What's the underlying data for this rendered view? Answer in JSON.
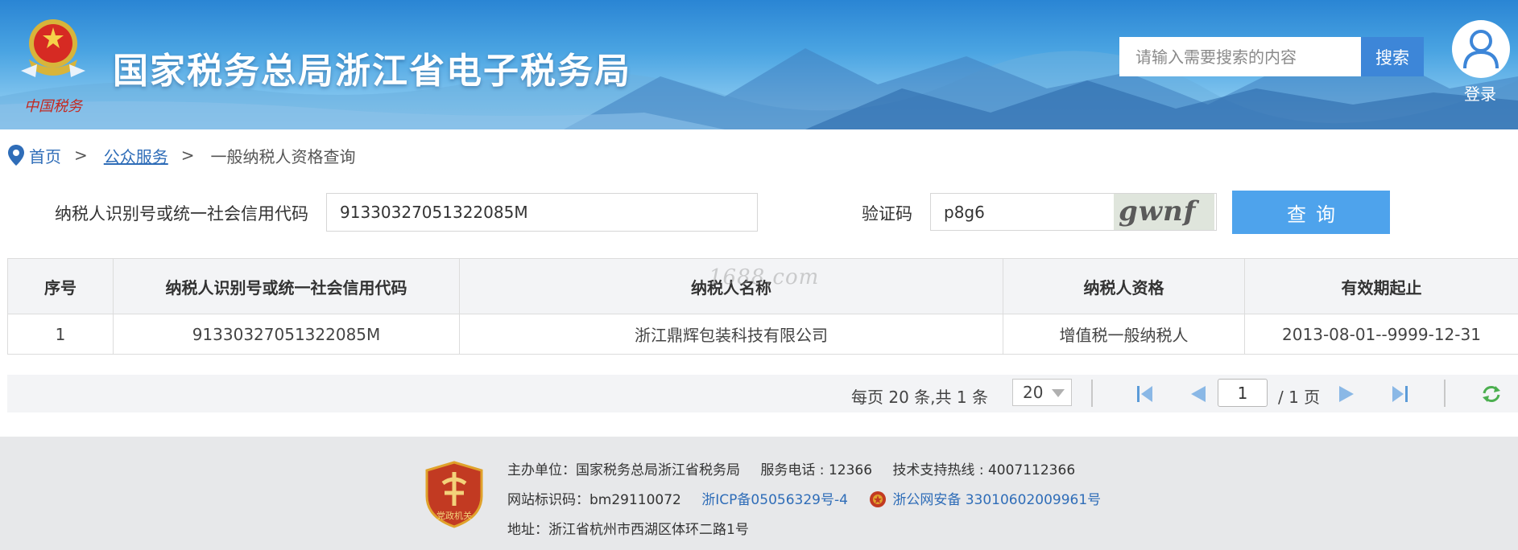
{
  "header": {
    "site_title": "国家税务总局浙江省电子税务局",
    "search_placeholder": "请输入需要搜索的内容",
    "search_button": "搜索",
    "login_label": "登录",
    "emblem_caption": "中国税务"
  },
  "breadcrumb": {
    "home": "首页",
    "separator": ">",
    "section": "公众服务",
    "current": "一般纳税人资格查询"
  },
  "form": {
    "code_label": "纳税人识别号或统一社会信用代码",
    "code_value": "91330327051322085M",
    "captcha_label": "验证码",
    "captcha_value": "p8g6",
    "captcha_image_text": "gwnf",
    "query_button": "查询"
  },
  "watermark": "1688.com",
  "table": {
    "columns": [
      "序号",
      "纳税人识别号或统一社会信用代码",
      "纳税人名称",
      "纳税人资格",
      "有效期起止"
    ],
    "rows": [
      [
        "1",
        "91330327051322085M",
        "浙江鼎辉包装科技有限公司",
        "增值税一般纳税人",
        "2013-08-01--9999-12-31"
      ]
    ]
  },
  "pager": {
    "summary": "每页 20 条,共 1 条",
    "page_size": "20",
    "current_page": "1",
    "total_pages": "/ 1 页"
  },
  "footer": {
    "host": "主办单位：国家税务总局浙江省税务局",
    "service_phone": "服务电话 : 12366",
    "tech_hotline": "技术支持热线 : 4007112366",
    "site_id": "网站标识码：bm29110072",
    "icp": "浙ICP备05056329号-4",
    "police_record": "浙公网安备 33010602009961号",
    "address": "地址：浙江省杭州市西湖区体环二路1号",
    "badge_text": "党政机关"
  },
  "colors": {
    "brand_blue": "#2f6db8",
    "query_button": "#4ea3ec",
    "search_button": "#3d86d8",
    "header_sky": "#4aa4e2"
  },
  "icons": {
    "location": "map-pin-icon",
    "user": "user-icon",
    "first": "first-page-icon",
    "prev": "prev-page-icon",
    "next": "next-page-icon",
    "last": "last-page-icon",
    "refresh": "refresh-icon"
  }
}
